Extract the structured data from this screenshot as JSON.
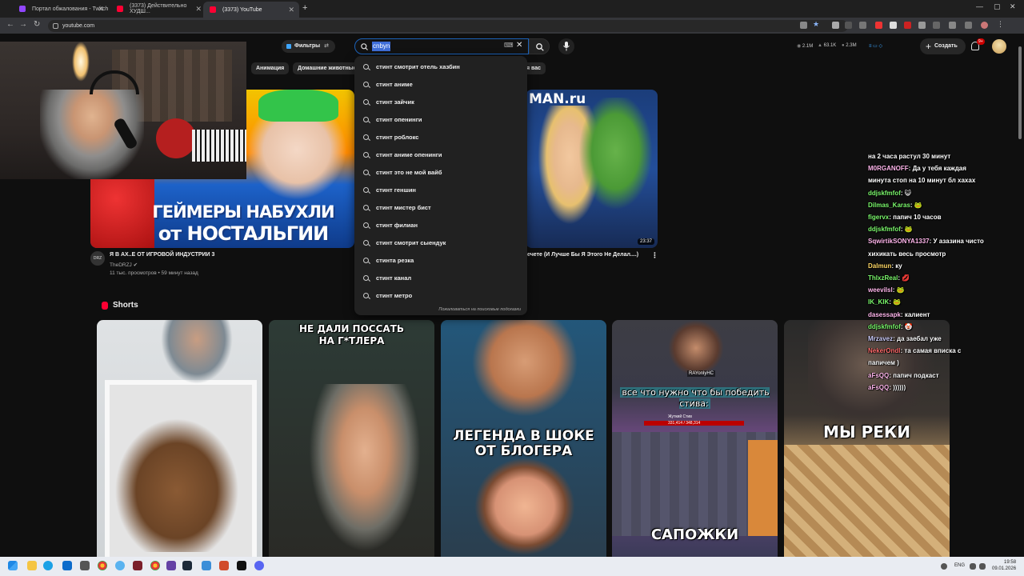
{
  "browser": {
    "tabs": [
      {
        "title": "Портал обжалования - Twitch",
        "color": "#9146ff"
      },
      {
        "title": "(3373) Действительно ХУДШ...",
        "color": "#ff0033"
      },
      {
        "title": "(3373) YouTube",
        "color": "#ff0033"
      }
    ],
    "url": "youtube.com"
  },
  "youtube": {
    "filters_label": "Фильтры",
    "search": {
      "query": "cnbyn"
    },
    "stats": [
      "2.1M",
      "63.1K",
      "2.3M"
    ],
    "create_label": "Создать",
    "bell_badge": "9+",
    "chips": [
      "Анимация",
      "Домашние животные",
      "я вас"
    ],
    "suggestions": [
      "стинт смотрит отель хазбин",
      "стинт аниме",
      "стинт зайчик",
      "стинт опенинги",
      "стинт роблокс",
      "стинт аниме опенинги",
      "стинт это не мой вайб",
      "стинт геншин",
      "стинт мистер бист",
      "стинт филиан",
      "стинт смотрит сыендук",
      "стинта резка",
      "стинт канал",
      "стинт метро"
    ],
    "suggest_report": "Пожаловаться на поисковые подсказки",
    "videos": [
      {
        "thumb_text_1": "ГЕЙМЕРЫ НАБУХЛИ",
        "thumb_text_2": "от НОСТАЛЬГИИ",
        "title": "Я В АХ..Е ОТ ИГРОВОЙ ИНДУСТРИИ 3",
        "channel": "TheDRZJ",
        "meta": "11 тыс. просмотров • 59 минут назад",
        "avatar": "DRZ"
      },
      {
        "thumb_text": "MAN.ru",
        "duration": "23:37",
        "title": "ечете (И Лучше Бы Я Этого Не Делал....)"
      }
    ],
    "shorts_label": "Shorts",
    "shorts": [
      {
        "caption": ""
      },
      {
        "caption": "НЕ ДАЛИ ПОССАТЬ НА Г*ТЛЕРА"
      },
      {
        "caption": "ЛЕГЕНДА В ШОКЕ ОТ БЛОГЕРА"
      },
      {
        "caption_top": "все что нужно что бы победить стива:",
        "caption": "САПОЖКИ",
        "streamer": "RAYonlyHC",
        "game_label": "Жуткий Стив",
        "hp": "331,414 / 348,314"
      },
      {
        "caption": "МЫ РЕКИ"
      }
    ]
  },
  "chat": [
    {
      "user": "",
      "color": "#ffffff",
      "text": "на 2 часа растул 30 минут"
    },
    {
      "user": "M0RGANOFF",
      "color": "#ffb6ec",
      "text": "Да у тебя каждая"
    },
    {
      "user": "",
      "color": "#ffffff",
      "text": "минута стоп на 10 минут бл хахах"
    },
    {
      "user": "ddjskfmfof",
      "color": "#7cf96d",
      "text": "😺"
    },
    {
      "user": "Dilmas_Karas",
      "color": "#7cf96d",
      "text": "🐸"
    },
    {
      "user": "figervx",
      "color": "#7cf96d",
      "text": "папич 10 часов"
    },
    {
      "user": "ddjskfmfof",
      "color": "#7cf96d",
      "text": "🐸"
    },
    {
      "user": "SqwirtikSONYA1337",
      "color": "#ffb6ec",
      "text": "У азазина чисто"
    },
    {
      "user": "",
      "color": "#ffffff",
      "text": "хихикать весь просмотр"
    },
    {
      "user": "Dalmun",
      "color": "#ffd866",
      "text": "ку"
    },
    {
      "user": "ThlxzReal",
      "color": "#7cf96d",
      "text": "💋"
    },
    {
      "user": "weevilsl",
      "color": "#ffb6ec",
      "text": "🐸"
    },
    {
      "user": "IK_KIK",
      "color": "#7cf96d",
      "text": "🐸"
    },
    {
      "user": "dasessapk",
      "color": "#ffb6ec",
      "text": "калиент"
    },
    {
      "user": "ddjskfmfof",
      "color": "#7cf96d",
      "text": "🤡"
    },
    {
      "user": "Mrzavez",
      "color": "#d0d0ff",
      "text": "да заебал уже"
    },
    {
      "user": "NekerOndl",
      "color": "#ff6b6b",
      "text": "та самая вписка с"
    },
    {
      "user": "",
      "color": "#ffffff",
      "text": "папичем )"
    },
    {
      "user": "aFsQQ",
      "color": "#ffb6ec",
      "text": "папич подкаст"
    },
    {
      "user": "aFsQQ",
      "color": "#ffb6ec",
      "text": "))))))"
    }
  ],
  "taskbar": {
    "lang": "ENG",
    "time": "19:58",
    "date": "09.01.2026"
  }
}
